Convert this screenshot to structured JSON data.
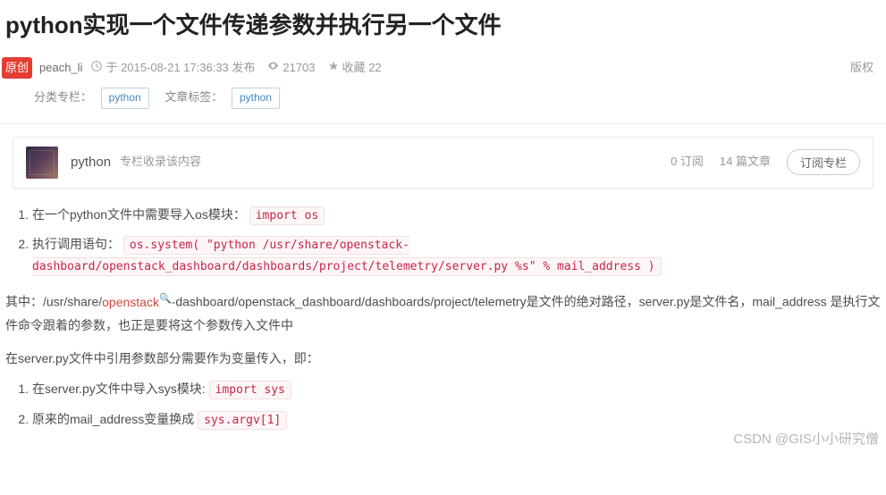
{
  "title": "python实现一个文件传递参数并执行另一个文件",
  "badge_original": "原创",
  "author": "peach_li",
  "publish_meta": "于 2015-08-21 17:36:33 发布",
  "views": "21703",
  "favorites_label": "收藏",
  "favorites_count": "22",
  "copyright": "版权",
  "category_label": "分类专栏：",
  "category_tag": "python",
  "tag_label": "文章标签：",
  "article_tag": "python",
  "column": {
    "name": "python",
    "desc": "专栏收录该内容",
    "subs": "0 订阅",
    "articles": "14 篇文章",
    "subscribe_btn": "订阅专栏"
  },
  "list1": {
    "item1_text": "在一个python文件中需要导入os模块： ",
    "item1_code": "import os",
    "item2_text": "执行调用语句： ",
    "item2_code": "os.system( \"python /usr/share/openstack-dashboard/openstack_dashboard/dashboards/project/telemetry/server.py %s\" % mail_address )"
  },
  "para1": {
    "pre": "其中：/usr/share/",
    "kw": "openstack",
    "post": "-dashboard/openstack_dashboard/dashboards/project/telemetry是文件的绝对路径，server.py是文件名，mail_address 是执行文件命令跟着的参数，也正是要将这个参数传入文件中"
  },
  "para2": "在server.py文件中引用参数部分需要作为变量传入，即：",
  "list2": {
    "item1_text": "在server.py文件中导入sys模块: ",
    "item1_code": "import sys",
    "item2_text": "原来的mail_address变量换成 ",
    "item2_code": "sys.argv[1]"
  },
  "watermark": "CSDN @GIS小小研究僧"
}
